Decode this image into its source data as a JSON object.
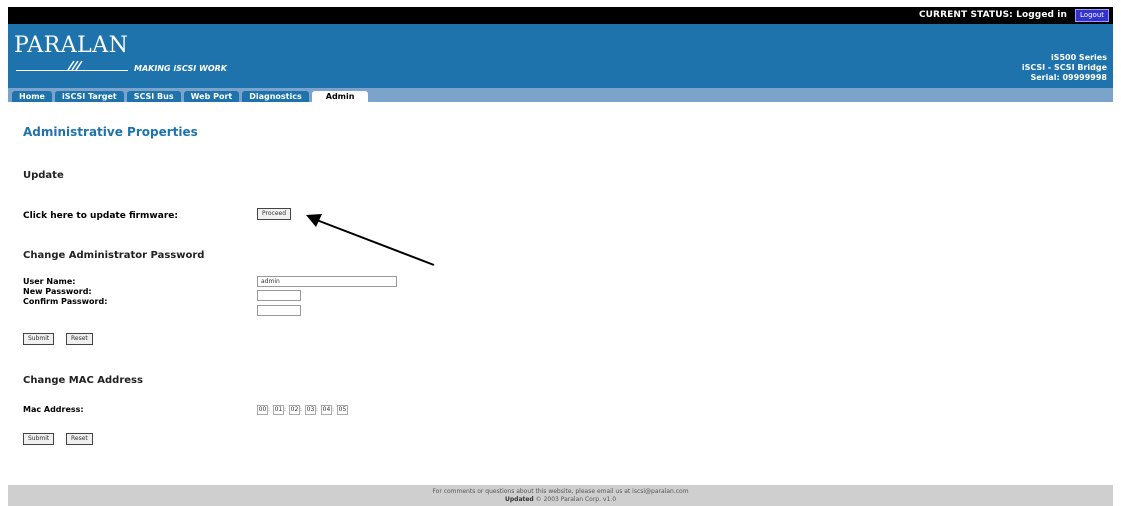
{
  "status_bar": {
    "status_text": "CURRENT STATUS: Logged in",
    "logout_label": "Logout"
  },
  "header": {
    "logo": "PARALAN",
    "tagline": "MAKING iSCSI WORK",
    "product_series": "iS500 Series",
    "product_name": "iSCSI - SCSI Bridge",
    "serial": "Serial: 09999998"
  },
  "tabs": [
    {
      "label": "Home",
      "active": false
    },
    {
      "label": "iSCSI Target",
      "active": false
    },
    {
      "label": "SCSI Bus",
      "active": false
    },
    {
      "label": "Web Port",
      "active": false
    },
    {
      "label": "Diagnostics",
      "active": false
    },
    {
      "label": "Admin",
      "active": true
    }
  ],
  "page": {
    "title": "Administrative Properties",
    "update": {
      "heading": "Update",
      "firmware_label": "Click here to update firmware:",
      "proceed_label": "Proceed"
    },
    "password": {
      "heading": "Change Administrator Password",
      "username_label": "User Name:",
      "username_value": "admin",
      "new_password_label": "New Password:",
      "new_password_value": "",
      "confirm_password_label": "Confirm Password:",
      "confirm_password_value": "",
      "submit_label": "Submit",
      "reset_label": "Reset"
    },
    "mac": {
      "heading": "Change MAC Address",
      "mac_label": "Mac Address:",
      "segments": [
        "00",
        "01",
        "02",
        "03",
        "04",
        "05"
      ],
      "submit_label": "Submit",
      "reset_label": "Reset"
    }
  },
  "footer": {
    "comment_text": "For comments or questions about this website, please email us at iscsi@paralan.com",
    "updated_label": "Updated",
    "copyright": "© 2003 Paralan Corp. v1.0"
  },
  "colors": {
    "header_blue": "#1e73ac",
    "tabbar_blue": "#7ba3cc",
    "footer_gray": "#cfcfcf"
  }
}
